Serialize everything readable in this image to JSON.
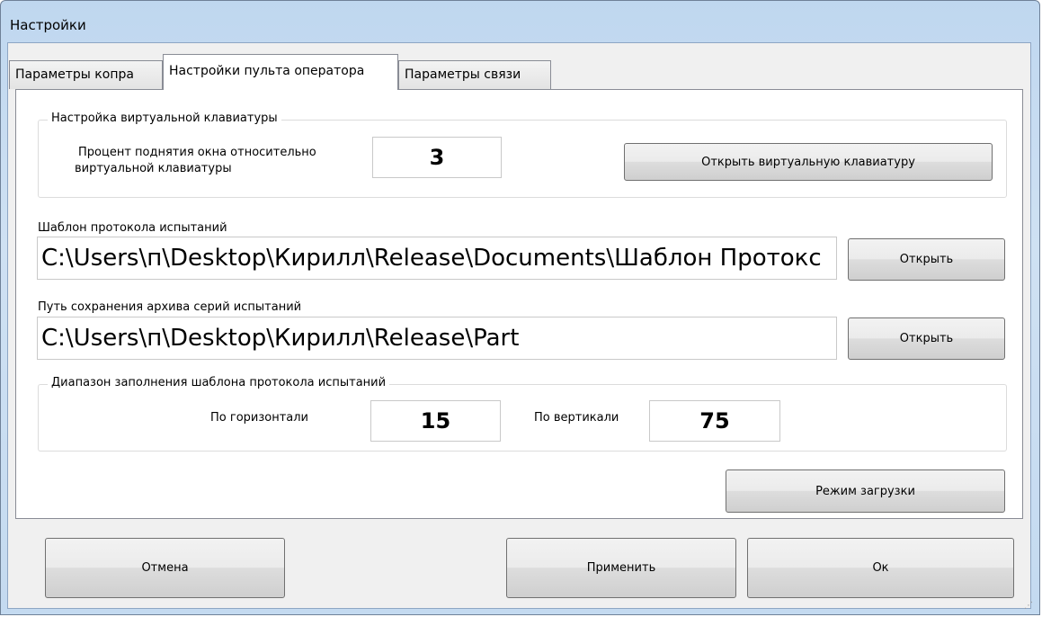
{
  "window": {
    "title": "Настройки"
  },
  "tabs": [
    {
      "label": "Параметры копра"
    },
    {
      "label": "Настройки пульта оператора"
    },
    {
      "label": "Параметры связи"
    }
  ],
  "keyboard_group": {
    "legend": "Настройка виртуальной клавиатуры",
    "percent_label_line1": "Процент поднятия окна относительно",
    "percent_label_line2": "виртуальной клавиатуры",
    "percent_value": "3",
    "open_keyboard_button": "Открыть виртуальную клавиатуру"
  },
  "template": {
    "label": "Шаблон протокола испытаний",
    "path": "C:\\Users\\п\\Desktop\\Кирилл\\Release\\Documents\\Шаблон Протокс",
    "open_button": "Открыть"
  },
  "archive": {
    "label": "Путь сохранения архива серий испытаний",
    "path": "C:\\Users\\п\\Desktop\\Кирилл\\Release\\Part",
    "open_button": "Открыть"
  },
  "range_group": {
    "legend": "Диапазон заполнения шаблона протокола испытаний",
    "horizontal_label": "По горизонтали",
    "horizontal_value": "15",
    "vertical_label": "По вертикали",
    "vertical_value": "75"
  },
  "load_mode_button": "Режим загрузки",
  "footer": {
    "cancel_button": "Отмена",
    "apply_button": "Применить",
    "ok_button": "Ок"
  },
  "icons": {
    "resize_grip": "resize-grip-icon"
  }
}
